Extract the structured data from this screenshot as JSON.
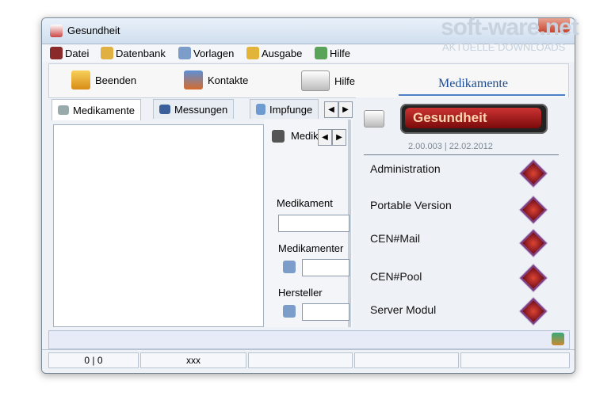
{
  "window": {
    "title": "Gesundheit"
  },
  "menu": [
    "Datei",
    "Datenbank",
    "Vorlagen",
    "Ausgabe",
    "Hilfe"
  ],
  "toolbar": {
    "beenden": "Beenden",
    "kontakte": "Kontakte",
    "hilfe": "Hilfe",
    "section_title": "Medikamente"
  },
  "tabs": [
    "Medikamente",
    "Messungen",
    "Impfunge"
  ],
  "mid": {
    "tab_label": "Medik",
    "medikament_label": "Medikament",
    "medikamenter_label": "Medikamenter",
    "hersteller_label": "Hersteller"
  },
  "right": {
    "logo_text": "Gesundheit",
    "version": "2.00.003 | 22.02.2012",
    "items": [
      "Administration",
      "Portable Version",
      "CEN#Mail",
      "CEN#Pool",
      "Server Modul"
    ]
  },
  "statusbar": {
    "cell1": "0 | 0",
    "cell2": "xxx"
  },
  "watermark": {
    "line1": "soft-ware.net",
    "line2": "AKTUELLE DOWNLOADS"
  },
  "colors": {
    "accent": "#1d4d94",
    "logo_red": "#c33"
  }
}
